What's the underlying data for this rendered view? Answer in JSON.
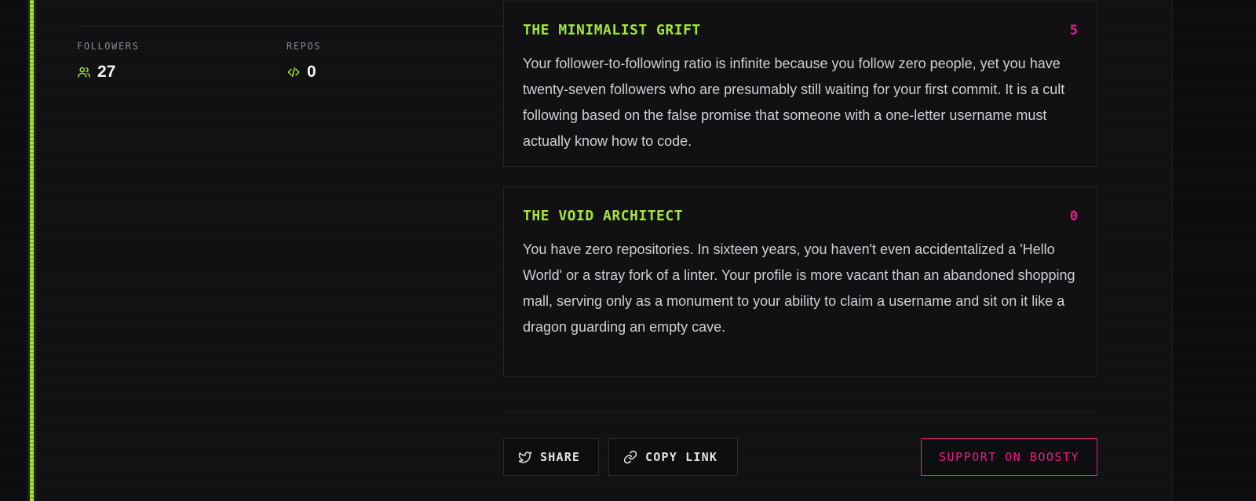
{
  "stats": {
    "followers": {
      "label": "FOLLOWERS",
      "value": "27",
      "icon": "users-icon"
    },
    "repos": {
      "label": "REPOS",
      "value": "0",
      "icon": "code-icon"
    }
  },
  "roasts": [
    {
      "title": "THE MINIMALIST GRIFT",
      "score": "5",
      "text": "Your follower-to-following ratio is infinite because you follow zero people, yet you have twenty-seven followers who are presumably still waiting for your first commit. It is a cult following based on the false promise that someone with a one-letter username must actually know how to code."
    },
    {
      "title": "THE VOID ARCHITECT",
      "score": "0",
      "text": "You have zero repositories. In sixteen years, you haven't even accidentalized a 'Hello World' or a stray fork of a linter. Your profile is more vacant than an abandoned shopping mall, serving only as a monument to your ability to claim a username and sit on it like a dragon guarding an empty cave."
    }
  ],
  "actions": {
    "share_label": "SHARE",
    "copy_link_label": "COPY LINK",
    "support_label": "SUPPORT ON BOOSTY"
  },
  "colors": {
    "accent": "#a3e635",
    "score": "#ec1c8c",
    "background": "#111114"
  }
}
